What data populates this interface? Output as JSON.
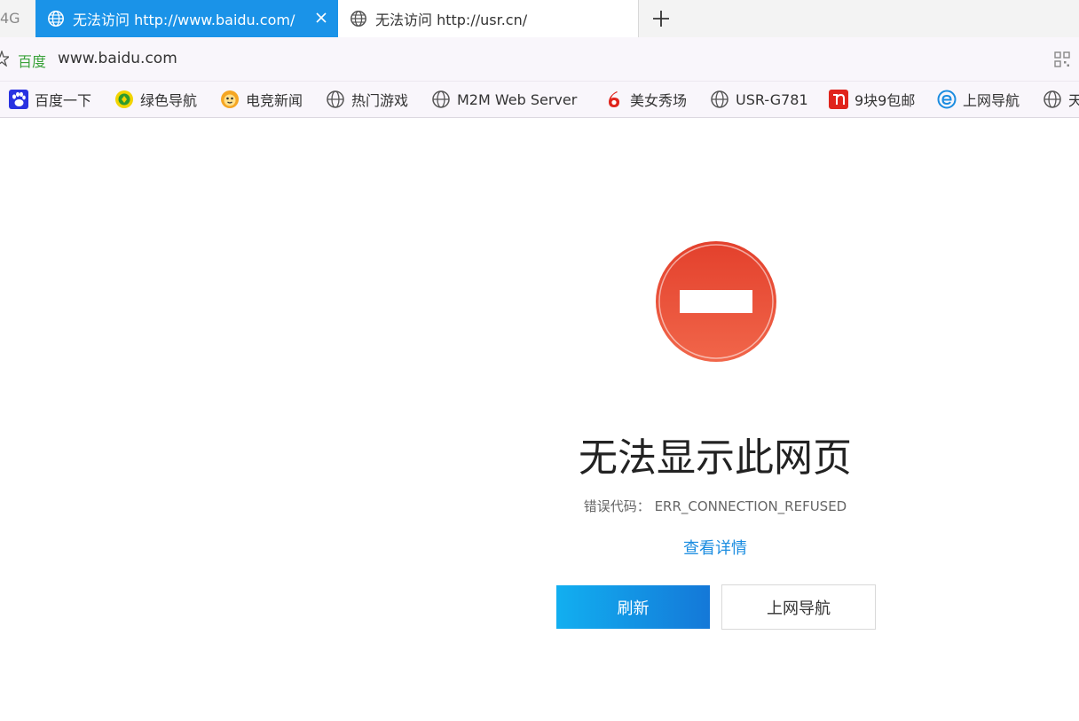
{
  "tabs": {
    "partial_label": "4G",
    "active": {
      "title": "无法访问 http://www.baidu.com/"
    },
    "inactive": {
      "title": "无法访问 http://usr.cn/"
    }
  },
  "address": {
    "site_badge": "百度",
    "url": "www.baidu.com"
  },
  "bookmarks": [
    {
      "label": "百度一下",
      "icon": "baidu-paw-icon"
    },
    {
      "label": "绿色导航",
      "icon": "green-nav-icon"
    },
    {
      "label": "电竞新闻",
      "icon": "tiger-face-icon"
    },
    {
      "label": "热门游戏",
      "icon": "globe-icon"
    },
    {
      "label": "M2M Web Server",
      "icon": "globe-icon"
    },
    {
      "label": "美女秀场",
      "icon": "red-six-icon"
    },
    {
      "label": "USR-G781",
      "icon": "globe-icon"
    },
    {
      "label": "9块9包邮",
      "icon": "red-nine-icon"
    },
    {
      "label": "上网导航",
      "icon": "ie-e-icon"
    },
    {
      "label": "天",
      "icon": "globe-icon"
    }
  ],
  "error": {
    "title": "无法显示此网页",
    "code_label": "错误代码：",
    "code_value": "ERR_CONNECTION_REFUSED",
    "details_link": "查看详情",
    "refresh_button": "刷新",
    "nav_button": "上网导航"
  },
  "colors": {
    "accent": "#1a93e8",
    "stop_red": "#e84c36",
    "link": "#1a8ce0"
  }
}
